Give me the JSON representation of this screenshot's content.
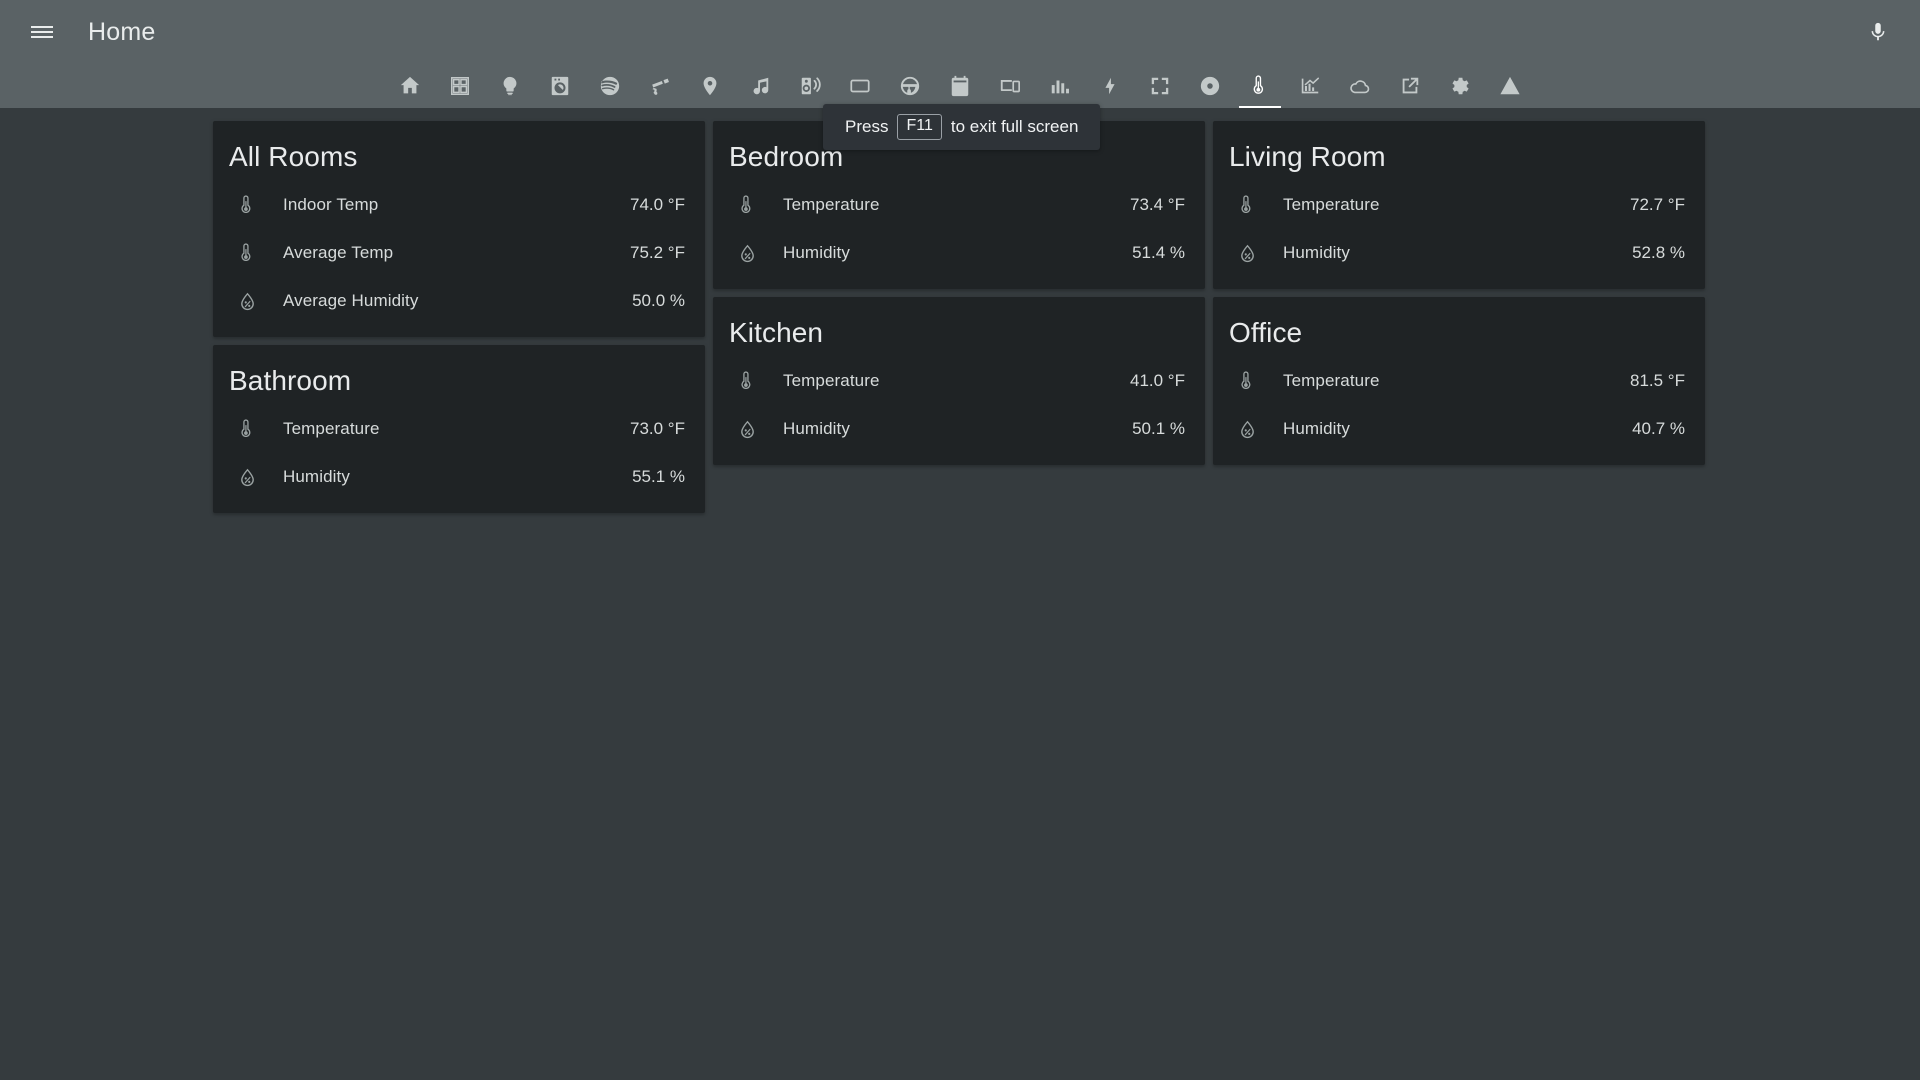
{
  "appbar": {
    "menu_icon": "hamburger-menu-icon",
    "title": "Home",
    "mic_icon": "microphone-icon"
  },
  "fullscreen_toast": {
    "prefix": "Press",
    "key": "F11",
    "suffix": "to exit full screen"
  },
  "tabs": [
    {
      "icon": "home-icon",
      "label": "Home",
      "active": false
    },
    {
      "icon": "view-dashboard-icon",
      "label": "Overview",
      "active": false
    },
    {
      "icon": "lightbulb-icon",
      "label": "Lights",
      "active": false
    },
    {
      "icon": "washing-machine-icon",
      "label": "Appliances",
      "active": false
    },
    {
      "icon": "spotify-icon",
      "label": "Spotify",
      "active": false
    },
    {
      "icon": "cctv-camera-icon",
      "label": "Cameras",
      "active": false
    },
    {
      "icon": "map-marker-icon",
      "label": "Presence",
      "active": false
    },
    {
      "icon": "music-note-icon",
      "label": "Music",
      "active": false
    },
    {
      "icon": "speaker-wireless-icon",
      "label": "Speakers",
      "active": false
    },
    {
      "icon": "television-icon",
      "label": "TV",
      "active": false
    },
    {
      "icon": "steering-wheel-icon",
      "label": "Car",
      "active": false
    },
    {
      "icon": "calendar-clock-icon",
      "label": "Calendar",
      "active": false
    },
    {
      "icon": "devices-icon",
      "label": "Devices",
      "active": false
    },
    {
      "icon": "chart-bar-icon",
      "label": "Statistics",
      "active": false
    },
    {
      "icon": "lightning-bolt-icon",
      "label": "Energy",
      "active": false
    },
    {
      "icon": "fullscreen-icon",
      "label": "Fullscreen",
      "active": false
    },
    {
      "icon": "album-icon",
      "label": "Media",
      "active": false
    },
    {
      "icon": "thermometer-icon",
      "label": "Climate",
      "active": true
    },
    {
      "icon": "chart-histogram-icon",
      "label": "History",
      "active": false
    },
    {
      "icon": "weather-cloudy-icon",
      "label": "Weather",
      "active": false
    },
    {
      "icon": "open-in-new-icon",
      "label": "External",
      "active": false
    },
    {
      "icon": "cog-icon",
      "label": "Settings",
      "active": false
    },
    {
      "icon": "alert-icon",
      "label": "Alerts",
      "active": false
    }
  ],
  "columns": [
    {
      "cards": [
        {
          "title": "All Rooms",
          "rows": [
            {
              "icon": "thermometer-icon",
              "name": "Indoor Temp",
              "value": "74.0 °F"
            },
            {
              "icon": "thermometer-icon",
              "name": "Average Temp",
              "value": "75.2 °F"
            },
            {
              "icon": "humidity-icon",
              "name": "Average Humidity",
              "value": "50.0 %"
            }
          ]
        },
        {
          "title": "Bathroom",
          "rows": [
            {
              "icon": "thermometer-icon",
              "name": "Temperature",
              "value": "73.0 °F"
            },
            {
              "icon": "humidity-icon",
              "name": "Humidity",
              "value": "55.1 %"
            }
          ]
        }
      ]
    },
    {
      "cards": [
        {
          "title": "Bedroom",
          "rows": [
            {
              "icon": "thermometer-icon",
              "name": "Temperature",
              "value": "73.4 °F"
            },
            {
              "icon": "humidity-icon",
              "name": "Humidity",
              "value": "51.4 %"
            }
          ]
        },
        {
          "title": "Kitchen",
          "rows": [
            {
              "icon": "thermometer-icon",
              "name": "Temperature",
              "value": "41.0 °F"
            },
            {
              "icon": "humidity-icon",
              "name": "Humidity",
              "value": "50.1 %"
            }
          ]
        }
      ]
    },
    {
      "cards": [
        {
          "title": "Living Room",
          "rows": [
            {
              "icon": "thermometer-icon",
              "name": "Temperature",
              "value": "72.7 °F"
            },
            {
              "icon": "humidity-icon",
              "name": "Humidity",
              "value": "52.8 %"
            }
          ]
        },
        {
          "title": "Office",
          "rows": [
            {
              "icon": "thermometer-icon",
              "name": "Temperature",
              "value": "81.5 °F"
            },
            {
              "icon": "humidity-icon",
              "name": "Humidity",
              "value": "40.7 %"
            }
          ]
        }
      ]
    }
  ],
  "colors": {
    "app_bar": "#5a6265",
    "background": "#353b3e",
    "card": "#1f2325",
    "primary_text": "#e9ebec",
    "secondary_text": "#d7dbdb",
    "icon": "#9aa2a2",
    "toast_bg": "#2e3338",
    "active_tab": "#ffffff"
  }
}
